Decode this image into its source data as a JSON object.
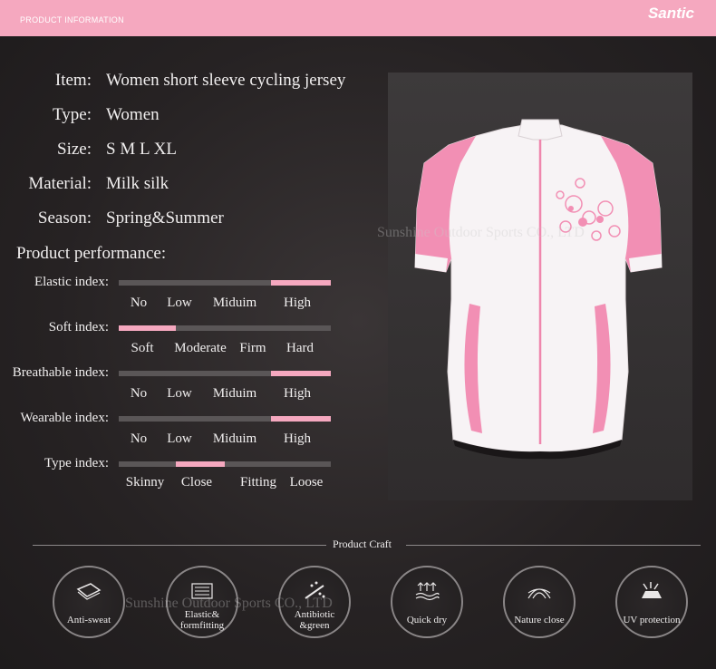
{
  "header": {
    "section_label": "PRODUCT INFORMATION",
    "brand": "Santic"
  },
  "specs": [
    {
      "key": "Item:",
      "value": "Women short sleeve cycling jersey"
    },
    {
      "key": "Type:",
      "value": "Women"
    },
    {
      "key": "Size:",
      "value": "S M L XL"
    },
    {
      "key": "Material:",
      "value": "Milk silk"
    },
    {
      "key": "Season:",
      "value": "Spring&Summer"
    }
  ],
  "performance": {
    "title": "Product performance:",
    "indices": [
      {
        "label": "Elastic index:",
        "options": [
          "No",
          "Low",
          "Miduim",
          "High"
        ],
        "selected_range": [
          0.72,
          1.0
        ]
      },
      {
        "label": "Soft index:",
        "options": [
          "Soft",
          "Moderate",
          "Firm",
          "Hard"
        ],
        "selected_range": [
          0.0,
          0.27
        ]
      },
      {
        "label": "Breathable index:",
        "options": [
          "No",
          "Low",
          "Miduim",
          "High"
        ],
        "selected_range": [
          0.72,
          1.0
        ]
      },
      {
        "label": "Wearable index:",
        "options": [
          "No",
          "Low",
          "Miduim",
          "High"
        ],
        "selected_range": [
          0.72,
          1.0
        ]
      },
      {
        "label": "Type index:",
        "options": [
          "Skinny",
          "Close",
          "Fitting",
          "Loose"
        ],
        "selected_range": [
          0.27,
          0.5
        ]
      }
    ],
    "accent_color": "#f5a8bf"
  },
  "photo": {
    "watermark": "Sunshine Outdoor Sports CO., LTD"
  },
  "craft": {
    "title": "Product Craft",
    "items": [
      {
        "label": "Anti-sweat",
        "icon": "fabric-icon"
      },
      {
        "label": "Elastic& formfitting",
        "icon": "stretch-icon"
      },
      {
        "label": "Antibiotic &green",
        "icon": "spray-icon"
      },
      {
        "label": "Quick dry",
        "icon": "evaporation-icon"
      },
      {
        "label": "Nature close",
        "icon": "mesh-icon"
      },
      {
        "label": "UV protection",
        "icon": "uv-icon"
      }
    ],
    "watermark": "Sunshine Outdoor Sports CO., LTD"
  }
}
